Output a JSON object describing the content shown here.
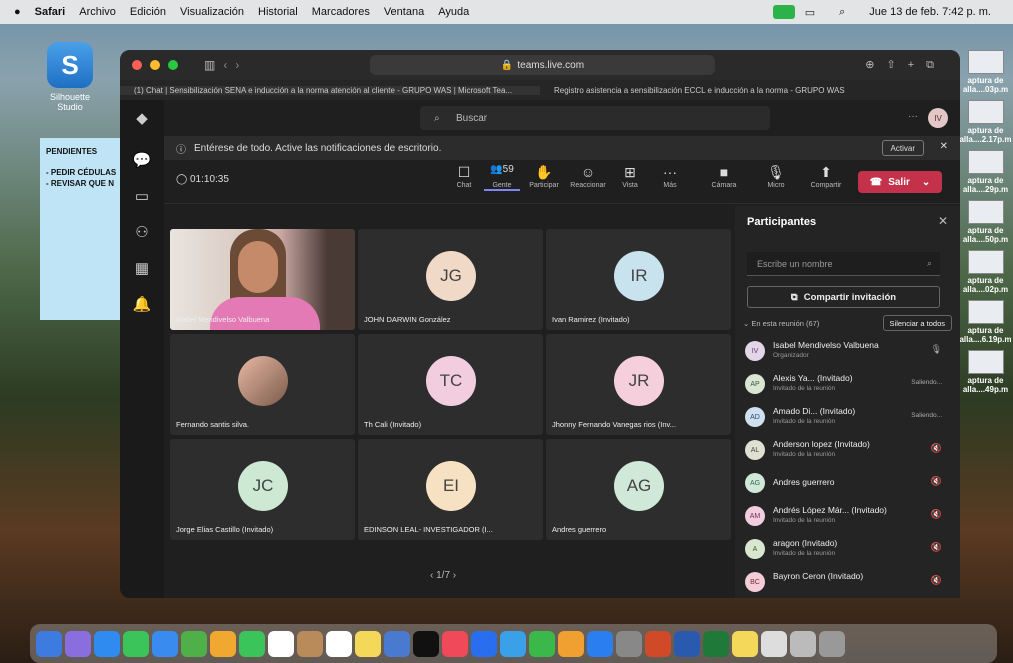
{
  "menubar": {
    "app": "Safari",
    "items": [
      "Archivo",
      "Edición",
      "Visualización",
      "Historial",
      "Marcadores",
      "Ventana",
      "Ayuda"
    ],
    "datetime": "Jue 13 de feb. 7:42 p. m."
  },
  "desktop": {
    "icon_label": "Silhouette Studio",
    "sticky": {
      "title": "PENDIENTES",
      "lines": [
        "- PEDIR CÉDULAS",
        "- REVISAR QUE N"
      ]
    },
    "thumbnails": [
      "aptura de\nalla....03p.m",
      "aptura de\nalla....2.17p.m",
      "aptura de\nalla....29p.m",
      "aptura de\nalla....50p.m",
      "aptura de\nalla....02p.m",
      "aptura de\nalla....6.19p.m",
      "aptura de\nalla....49p.m"
    ]
  },
  "safari": {
    "url": "teams.live.com",
    "tab1": "(1) Chat | Sensibilización SENA e inducción a la norma atención al cliente - GRUPO WAS | Microsoft Tea...",
    "tab2": "Registro asistencia a sensibilización ECCL e inducción a la norma - GRUPO WAS"
  },
  "teams": {
    "search_placeholder": "Buscar",
    "top_avatar": "IV",
    "notification": "Entérese de todo. Active las notificaciones de escritorio.",
    "activate": "Activar",
    "timer": "01:10:35",
    "toolbar": [
      {
        "icon": "chat-icon",
        "glyph": "☐",
        "label": "Chat"
      },
      {
        "icon": "people-icon",
        "glyph": "👥59",
        "label": "Gente"
      },
      {
        "icon": "raise-hand-icon",
        "glyph": "✋",
        "label": "Participar"
      },
      {
        "icon": "react-icon",
        "glyph": "☺",
        "label": "Reaccionar"
      },
      {
        "icon": "view-icon",
        "glyph": "⊞",
        "label": "Vista"
      },
      {
        "icon": "more-icon",
        "glyph": "···",
        "label": "Más"
      },
      {
        "icon": "camera-icon",
        "glyph": "■",
        "label": "Cámara"
      },
      {
        "icon": "mic-icon",
        "glyph": "🎙",
        "label": "Micro"
      },
      {
        "icon": "share-icon",
        "glyph": "⬆",
        "label": "Compartir"
      }
    ],
    "leave": "Salir",
    "tiles": [
      {
        "name": "Isabel Mendivelso Valbuena",
        "initials": "",
        "bg": "#d9a6a0",
        "video": true
      },
      {
        "name": "JOHN DARWIN González",
        "initials": "JG",
        "bg": "#f0d9c6"
      },
      {
        "name": "Ivan Ramirez (Invitado)",
        "initials": "IR",
        "bg": "#c9e3ee"
      },
      {
        "name": "Fernando santis silva.",
        "initials": "",
        "bg": "#e8b9a5",
        "photo": true
      },
      {
        "name": "Th Cali (Invitado)",
        "initials": "TC",
        "bg": "#f2cde0"
      },
      {
        "name": "Jhonny Fernando Vanegas rios (Inv...",
        "initials": "JR",
        "bg": "#f5d0dc"
      },
      {
        "name": "Jorge Elias Castillo (Invitado)",
        "initials": "JC",
        "bg": "#cde9d4"
      },
      {
        "name": "EDINSON LEAL- INVESTIGADOR (I...",
        "initials": "EI",
        "bg": "#f6e2c3"
      },
      {
        "name": "Andres guerrero",
        "initials": "AG",
        "bg": "#cfe8d8"
      }
    ],
    "pager": "1/7"
  },
  "panel": {
    "title": "Participantes",
    "search_placeholder": "Escribe un nombre",
    "invite": "Compartir invitación",
    "in_meeting": "En esta reunión (67)",
    "silence_all": "Silenciar a todos",
    "participants": [
      {
        "initials": "IV",
        "name": "Isabel Mendivelso Valbuena",
        "role": "Organizador",
        "status": "",
        "bg": "#e3d6e8"
      },
      {
        "initials": "AP",
        "name": "Alexis Ya...  (Invitado)",
        "role": "Invitado de la reunión",
        "status": "Saliendo...",
        "bg": "#d8e6d3"
      },
      {
        "initials": "AD",
        "name": "Amado Di...  (Invitado)",
        "role": "Invitado de la reunión",
        "status": "Saliendo...",
        "bg": "#cfe0f0"
      },
      {
        "initials": "AL",
        "name": "Anderson lopez (Invitado)",
        "role": "Invitado de la reunión",
        "status": "",
        "bg": "#e0e0d2"
      },
      {
        "initials": "AG",
        "name": "Andres guerrero",
        "role": "",
        "status": "",
        "bg": "#cfe8d8"
      },
      {
        "initials": "AM",
        "name": "Andrés López Már...  (Invitado)",
        "role": "Invitado de la reunión",
        "status": "",
        "bg": "#f1cde0"
      },
      {
        "initials": "A",
        "name": "aragon (Invitado)",
        "role": "Invitado de la reunión",
        "status": "",
        "bg": "#d9e7d0"
      },
      {
        "initials": "BC",
        "name": "Bayron Ceron (Invitado)",
        "role": "",
        "status": "",
        "bg": "#f3cdd8"
      }
    ]
  }
}
